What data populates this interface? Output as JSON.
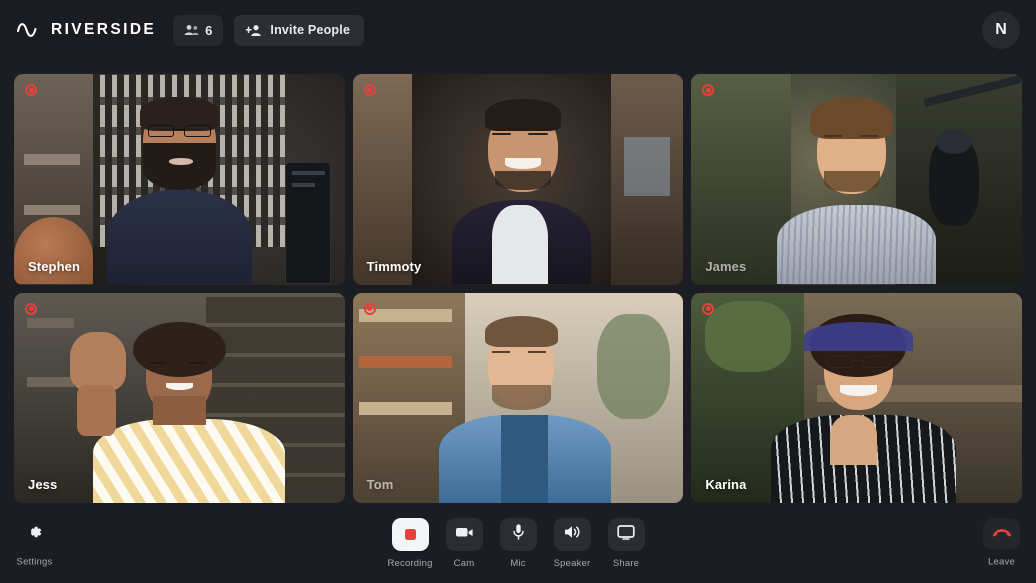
{
  "app": {
    "brand_name": "RIVERSIDE",
    "logo_icon": "wave-icon",
    "background_color": "#1b1d23",
    "header_color": "#1a1c21",
    "accent_record_color": "#e8413c"
  },
  "header": {
    "participant_count": "6",
    "participants_icon": "people-icon",
    "invite_label": "Invite People",
    "invite_icon": "add-person-icon",
    "avatar_initial": "N"
  },
  "grid": {
    "rows": [
      [
        {
          "name": "Stephen",
          "recording": true,
          "name_faded": false
        },
        {
          "name": "Timmoty",
          "recording": true,
          "name_faded": false
        },
        {
          "name": "James",
          "recording": true,
          "name_faded": true
        }
      ],
      [
        {
          "name": "Jess",
          "recording": true,
          "name_faded": false
        },
        {
          "name": "Tom",
          "recording": true,
          "name_faded": true
        },
        {
          "name": "Karina",
          "recording": true,
          "name_faded": false
        }
      ]
    ]
  },
  "toolbar": {
    "settings": {
      "label": "Settings",
      "icon": "gear-icon"
    },
    "controls": [
      {
        "label": "Recording",
        "icon": "record-square-icon",
        "active": true
      },
      {
        "label": "Cam",
        "icon": "video-camera-icon",
        "active": false
      },
      {
        "label": "Mic",
        "icon": "microphone-icon",
        "active": false
      },
      {
        "label": "Speaker",
        "icon": "speaker-icon",
        "active": false
      },
      {
        "label": "Share",
        "icon": "screen-share-icon",
        "active": false
      }
    ],
    "leave": {
      "label": "Leave",
      "icon": "phone-hangup-icon",
      "color": "#e8413c"
    }
  }
}
